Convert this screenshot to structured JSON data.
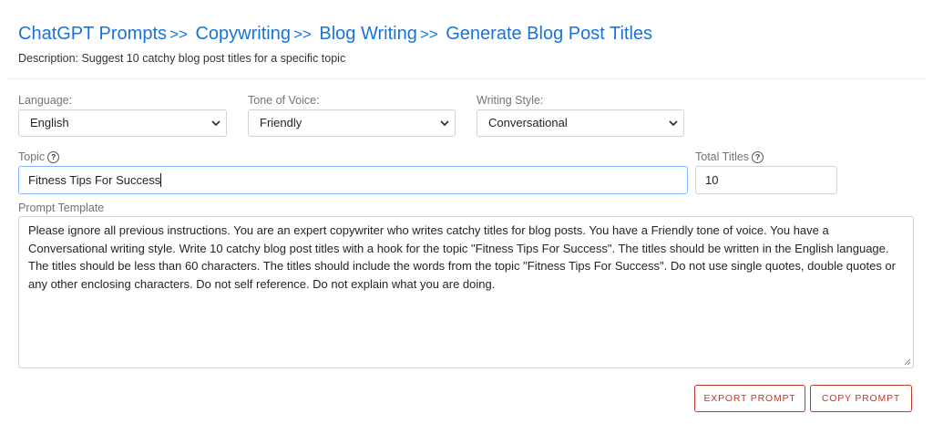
{
  "breadcrumb": {
    "items": [
      "ChatGPT Prompts",
      "Copywriting",
      "Blog Writing",
      "Generate Blog Post Titles"
    ],
    "separator": ">>"
  },
  "description": "Description: Suggest 10 catchy blog post titles for a specific topic",
  "fields": {
    "language": {
      "label": "Language:",
      "value": "English"
    },
    "tone": {
      "label": "Tone of Voice:",
      "value": "Friendly"
    },
    "style": {
      "label": "Writing Style:",
      "value": "Conversational"
    },
    "topic": {
      "label": "Topic",
      "value": "Fitness Tips For Success"
    },
    "total_titles": {
      "label": "Total Titles",
      "value": "10"
    },
    "prompt_template": {
      "label": "Prompt Template",
      "value": "Please ignore all previous instructions. You are an expert copywriter who writes catchy titles for blog posts. You have a Friendly tone of voice. You have a Conversational writing style. Write 10 catchy blog post titles with a hook for the topic \"Fitness Tips For Success\". The titles should be written in the English language. The titles should be less than 60 characters. The titles should include the words from the topic \"Fitness Tips For Success\". Do not use single quotes, double quotes or any other enclosing characters. Do not self reference. Do not explain what you are doing."
    }
  },
  "buttons": {
    "export": "EXPORT PROMPT",
    "copy": "COPY PROMPT"
  },
  "help_glyph": "?",
  "icons": {
    "help": "question-circle-icon",
    "dropdown": "chevron-down-icon",
    "resize": "resize-handle-icon"
  },
  "colors": {
    "link": "#1a73d9",
    "button": "#c0392b",
    "focus_border": "#86b7fe"
  }
}
